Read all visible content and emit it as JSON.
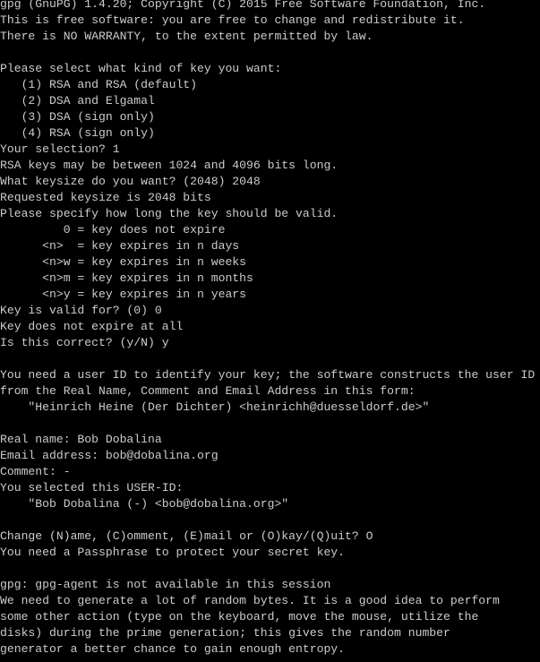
{
  "terminal": {
    "text_color": "#cccccc",
    "background_color": "#000000",
    "lines": [
      "gpg (GnuPG) 1.4.20; Copyright (C) 2015 Free Software Foundation, Inc.",
      "This is free software: you are free to change and redistribute it.",
      "There is NO WARRANTY, to the extent permitted by law.",
      "",
      "Please select what kind of key you want:",
      "   (1) RSA and RSA (default)",
      "   (2) DSA and Elgamal",
      "   (3) DSA (sign only)",
      "   (4) RSA (sign only)",
      "Your selection? 1",
      "RSA keys may be between 1024 and 4096 bits long.",
      "What keysize do you want? (2048) 2048",
      "Requested keysize is 2048 bits",
      "Please specify how long the key should be valid.",
      "         0 = key does not expire",
      "      <n>  = key expires in n days",
      "      <n>w = key expires in n weeks",
      "      <n>m = key expires in n months",
      "      <n>y = key expires in n years",
      "Key is valid for? (0) 0",
      "Key does not expire at all",
      "Is this correct? (y/N) y",
      "",
      "You need a user ID to identify your key; the software constructs the user ID",
      "from the Real Name, Comment and Email Address in this form:",
      "    \"Heinrich Heine (Der Dichter) <heinrichh@duesseldorf.de>\"",
      "",
      "Real name: Bob Dobalina",
      "Email address: bob@dobalina.org",
      "Comment: -",
      "You selected this USER-ID:",
      "    \"Bob Dobalina (-) <bob@dobalina.org>\"",
      "",
      "Change (N)ame, (C)omment, (E)mail or (O)kay/(Q)uit? O",
      "You need a Passphrase to protect your secret key.",
      "",
      "gpg: gpg-agent is not available in this session",
      "We need to generate a lot of random bytes. It is a good idea to perform",
      "some other action (type on the keyboard, move the mouse, utilize the",
      "disks) during the prime generation; this gives the random number",
      "generator a better chance to gain enough entropy."
    ]
  }
}
